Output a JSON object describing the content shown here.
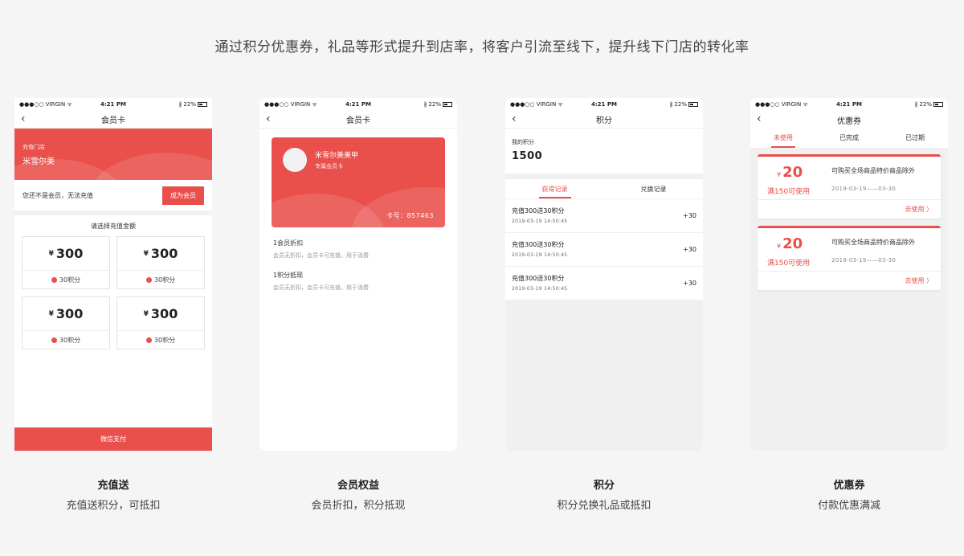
{
  "headline": "通过积分优惠券，礼品等形式提升到店率，将客户引流至线下，提升线下门店的转化率",
  "status": {
    "carrier": "●●●○○ VIRGIN ᯤ",
    "time": "4:21 PM",
    "battery": "∦ 22%"
  },
  "screen1": {
    "nav_title": "会员卡",
    "store_label": "充值门店",
    "store_name": "米雪尔美",
    "notice": "您还不是会员，无法充值",
    "become_member": "成为会员",
    "select_title": "请选择充值金额",
    "amounts": [
      {
        "currency": "¥",
        "value": "300",
        "points": "30积分"
      },
      {
        "currency": "¥",
        "value": "300",
        "points": "30积分"
      },
      {
        "currency": "¥",
        "value": "300",
        "points": "30积分"
      },
      {
        "currency": "¥",
        "value": "300",
        "points": "30积分"
      }
    ],
    "pay": "微信支付"
  },
  "screen2": {
    "nav_title": "会员卡",
    "member_name": "米雪尔美美甲",
    "card_type": "专属会员卡",
    "card_no": "卡号：857463",
    "benefits": [
      {
        "title": "1会员折扣",
        "desc": "会员无折扣，会员卡可充值，用于消费"
      },
      {
        "title": "1积分抵现",
        "desc": "会员无折扣，会员卡可充值，用于消费"
      }
    ]
  },
  "screen3": {
    "nav_title": "积分",
    "points_label": "我的积分",
    "points_value": "1500",
    "tabs": [
      "获得记录",
      "兑换记录"
    ],
    "records": [
      {
        "title": "充值300送30积分",
        "date": "2019-03-19 14:50:45",
        "value": "+30"
      },
      {
        "title": "充值300送30积分",
        "date": "2019-03-19 14:50:45",
        "value": "+30"
      },
      {
        "title": "充值300送30积分",
        "date": "2019-03-19 14:50:45",
        "value": "+30"
      }
    ]
  },
  "screen4": {
    "nav_title": "优惠券",
    "tabs": [
      "未使用",
      "已完成",
      "已过期"
    ],
    "coupons": [
      {
        "currency": "¥",
        "amount": "20",
        "condition": "满150可使用",
        "desc": "可购买全场商品特价商品除外",
        "date": "2019-03-19——03-30",
        "use": "去使用 〉"
      },
      {
        "currency": "¥",
        "amount": "20",
        "condition": "满150可使用",
        "desc": "可购买全场商品特价商品除外",
        "date": "2019-03-19——03-30",
        "use": "去使用 〉"
      }
    ]
  },
  "captions": [
    {
      "title": "充值送",
      "subtitle": "充值送积分，可抵扣"
    },
    {
      "title": "会员权益",
      "subtitle": "会员折扣，积分抵现"
    },
    {
      "title": "积分",
      "subtitle": "积分兑换礼品或抵扣"
    },
    {
      "title": "优惠券",
      "subtitle": "付款优惠满减"
    }
  ],
  "colors": {
    "accent": "#e94f4b",
    "background": "#f5f5f5"
  }
}
